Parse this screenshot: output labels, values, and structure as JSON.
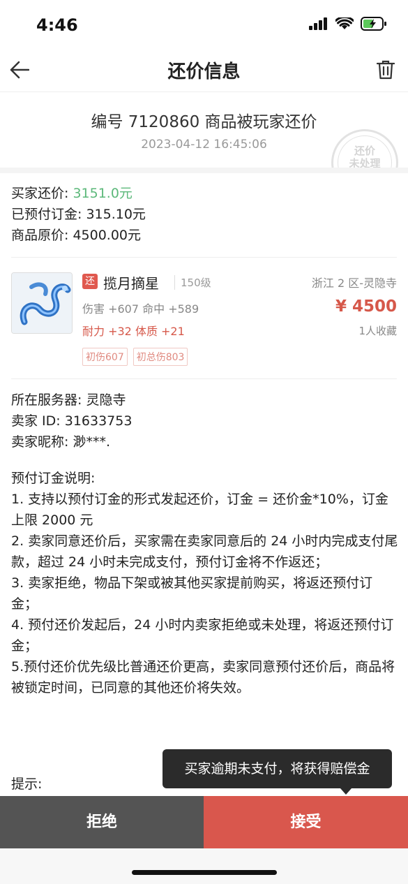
{
  "status_bar": {
    "time": "4:46"
  },
  "nav": {
    "title": "还价信息"
  },
  "header": {
    "title": "编号 7120860 商品被玩家还价",
    "timestamp": "2023-04-12 16:45:06",
    "stamp_line1": "还价",
    "stamp_line2": "未处理"
  },
  "prices": {
    "buyer_offer_label": "买家还价:",
    "buyer_offer_value": "3151.0元",
    "deposit_label": "已预付订金:",
    "deposit_value": "315.10元",
    "original_label": "商品原价:",
    "original_value": "4500.00元"
  },
  "item": {
    "badge": "还",
    "name": "揽月摘星",
    "level": "150级",
    "stat_line1": "伤害 +607 命中 +589",
    "stat_line2": "耐力 +32 体质 +21",
    "tags": [
      "初伤607",
      "初总伤803"
    ],
    "server": "浙江 2 区-灵隐寺",
    "price": "¥ 4500",
    "favorites": "1人收藏"
  },
  "seller": {
    "server_label": "所在服务器:",
    "server_value": "灵隐寺",
    "id_label": "卖家 ID:",
    "id_value": "31633753",
    "nickname_label": "卖家昵称:",
    "nickname_value": "渺***."
  },
  "rules": {
    "heading": "预付订金说明:",
    "items": [
      "1. 支持以预付订金的形式发起还价，订金 = 还价金*10%，订金上限 2000 元",
      "2. 卖家同意还价后，买家需在卖家同意后的 24 小时内完成支付尾款，超过 24 小时未完成支付，预付订金将不作返还；",
      "3. 卖家拒绝，物品下架或被其他买家提前购买，将返还预付订金；",
      "4. 预付还价发起后，24 小时内卖家拒绝或未处理，将返还预付订金；",
      "5.预付还价优先级比普通还价更高，卖家同意预付还价后，商品将被锁定时间，已同意的其他还价将失效。"
    ]
  },
  "tip": {
    "label": "提示:"
  },
  "tooltip": {
    "text": "买家逾期未支付，将获得赔偿金"
  },
  "actions": {
    "reject_label": "拒绝",
    "accept_label": "接受"
  },
  "colors": {
    "accent_red": "#d9574d",
    "reject_gray": "#545454",
    "offer_green": "#5cb87a"
  }
}
